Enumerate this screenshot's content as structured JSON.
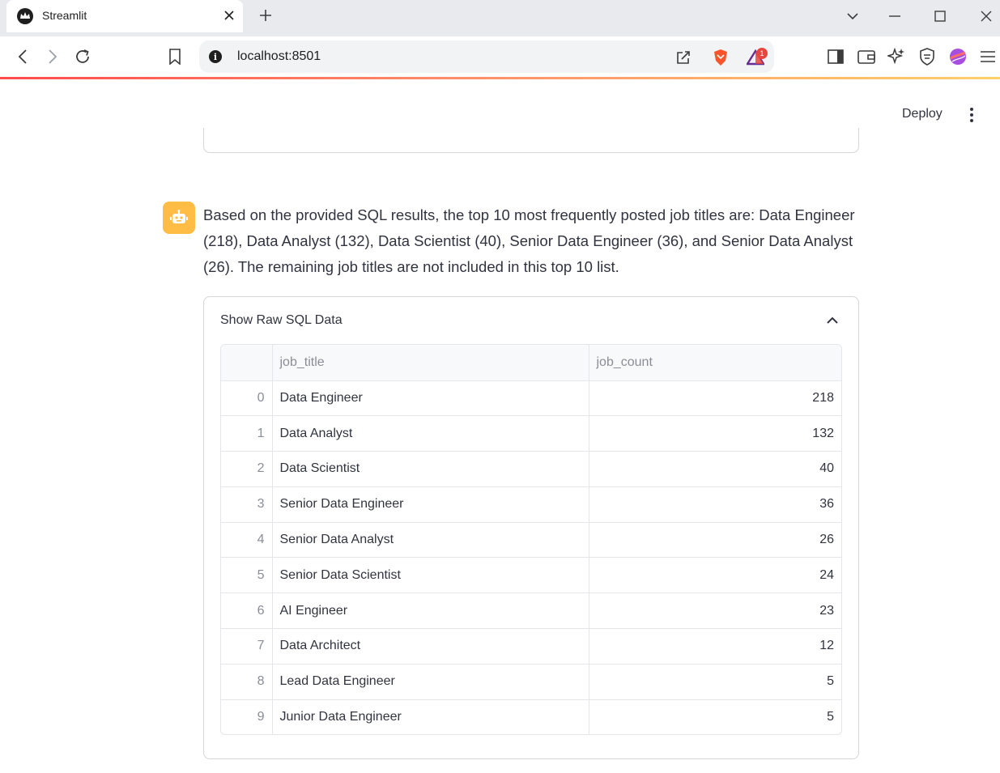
{
  "browser": {
    "tab_title": "Streamlit",
    "url": "localhost:8501",
    "notification_count": "1"
  },
  "app": {
    "deploy_label": "Deploy"
  },
  "chat": {
    "assistant_message": "Based on the provided SQL results, the top 10 most frequently posted job titles are: Data Engineer (218), Data Analyst (132), Data Scientist (40), Senior Data Engineer (36), and Senior Data Analyst (26). The remaining job titles are not included in this top 10 list.",
    "expander_label": "Show Raw SQL Data",
    "table": {
      "columns": [
        "job_title",
        "job_count"
      ],
      "rows": [
        {
          "index": "0",
          "job_title": "Data Engineer",
          "job_count": "218"
        },
        {
          "index": "1",
          "job_title": "Data Analyst",
          "job_count": "132"
        },
        {
          "index": "2",
          "job_title": "Data Scientist",
          "job_count": "40"
        },
        {
          "index": "3",
          "job_title": "Senior Data Engineer",
          "job_count": "36"
        },
        {
          "index": "4",
          "job_title": "Senior Data Analyst",
          "job_count": "26"
        },
        {
          "index": "5",
          "job_title": "Senior Data Scientist",
          "job_count": "24"
        },
        {
          "index": "6",
          "job_title": "AI Engineer",
          "job_count": "23"
        },
        {
          "index": "7",
          "job_title": "Data Architect",
          "job_count": "12"
        },
        {
          "index": "8",
          "job_title": "Lead Data Engineer",
          "job_count": "5"
        },
        {
          "index": "9",
          "job_title": "Junior Data Engineer",
          "job_count": "5"
        }
      ]
    }
  },
  "colors": {
    "avatar_bg": "#ffbd45",
    "accent": "#ff4b4b"
  }
}
